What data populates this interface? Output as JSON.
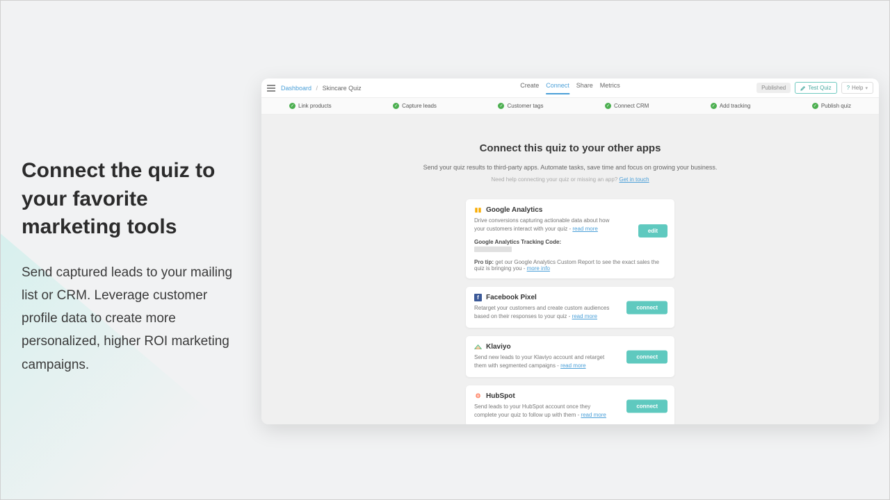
{
  "marketing": {
    "title": "Connect the quiz to your favorite marketing tools",
    "subtitle": "Send captured leads to your mailing list or CRM. Leverage customer profile data to create more personalized, higher ROI marketing campaigns."
  },
  "topbar": {
    "breadcrumb_root": "Dashboard",
    "breadcrumb_sep": "/",
    "breadcrumb_current": "Skincare Quiz",
    "tabs": {
      "create": "Create",
      "connect": "Connect",
      "share": "Share",
      "metrics": "Metrics"
    },
    "published": "Published",
    "test": "Test Quiz",
    "help": "Help"
  },
  "steps": {
    "s1": "Link products",
    "s2": "Capture leads",
    "s3": "Customer tags",
    "s4": "Connect CRM",
    "s5": "Add tracking",
    "s6": "Publish quiz"
  },
  "body": {
    "title": "Connect this quiz to your other apps",
    "subtitle": "Send your quiz results to third-party apps. Automate tasks, save time and focus on growing your business.",
    "help_prefix": "Need help connecting your quiz or missing an app? ",
    "help_link": "Get in touch"
  },
  "apps": {
    "ga": {
      "title": "Google Analytics",
      "desc": "Drive conversions capturing actionable data about how your customers interact with your quiz - ",
      "read_more": "read more",
      "tracking_label": "Google Analytics Tracking Code:",
      "protip_label": "Pro tip:",
      "protip_text": " get our Google Analytics Custom Report to see the exact sales the quiz is bringing you - ",
      "more_info": "more info",
      "btn": "edit"
    },
    "fb": {
      "title": "Facebook Pixel",
      "desc": "Retarget your customers and create custom audiences based on their responses to your quiz - ",
      "read_more": "read more",
      "btn": "connect"
    },
    "kl": {
      "title": "Klaviyo",
      "desc": "Send new leads to your Klaviyo account and retarget them with segmented campaigns - ",
      "read_more": "read more",
      "btn": "connect"
    },
    "hs": {
      "title": "HubSpot",
      "desc": "Send leads to your HubSpot account once they complete your quiz to follow up with them - ",
      "read_more": "read more",
      "btn": "connect"
    }
  }
}
